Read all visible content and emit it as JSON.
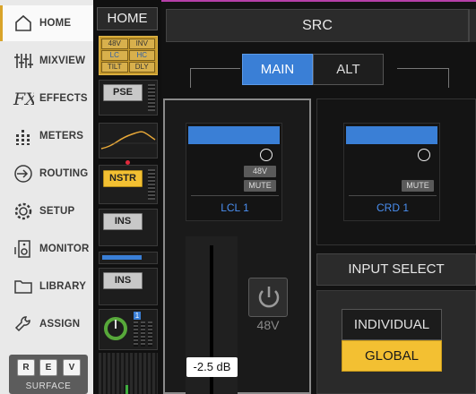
{
  "sidebar": {
    "items": [
      {
        "label": "HOME",
        "icon": "home-icon",
        "active": true
      },
      {
        "label": "MIXVIEW",
        "icon": "mixer-sliders-icon"
      },
      {
        "label": "EFFECTS",
        "icon": "fx-icon"
      },
      {
        "label": "METERS",
        "icon": "meters-icon"
      },
      {
        "label": "ROUTING",
        "icon": "routing-arrow-icon"
      },
      {
        "label": "SETUP",
        "icon": "gear-icon"
      },
      {
        "label": "MONITOR",
        "icon": "speaker-icon"
      },
      {
        "label": "LIBRARY",
        "icon": "folder-icon"
      },
      {
        "label": "ASSIGN",
        "icon": "wrench-icon"
      }
    ],
    "surface": {
      "buttons": [
        "R",
        "E",
        "V"
      ],
      "label": "SURFACE"
    }
  },
  "strip": {
    "title": "HOME",
    "processing_tags": [
      "48V",
      "INV",
      "LC",
      "HC",
      "TILT",
      "DLY"
    ],
    "pse_label": "PSE",
    "nstr_label": "NSTR",
    "ins1_label": "INS",
    "ins2_label": "INS",
    "badge": "1"
  },
  "main": {
    "src_title": "SRC",
    "tabs": [
      {
        "label": "MAIN",
        "active": true
      },
      {
        "label": "ALT",
        "active": false
      }
    ],
    "channel_left": {
      "name": "LCL 1",
      "tag_48v": "48V",
      "tag_mute": "MUTE"
    },
    "channel_right": {
      "name": "CRD 1",
      "tag_mute": "MUTE"
    },
    "gain_value": "-2.5 dB",
    "phantom_label": "48V",
    "input_select_label": "INPUT SELECT",
    "individual_label": "INDIVIDUAL",
    "global_label": "GLOBAL"
  },
  "colors": {
    "accent_blue": "#3a7fd6",
    "accent_yellow": "#f3c032",
    "active_nav_bar": "#d9a42a"
  }
}
